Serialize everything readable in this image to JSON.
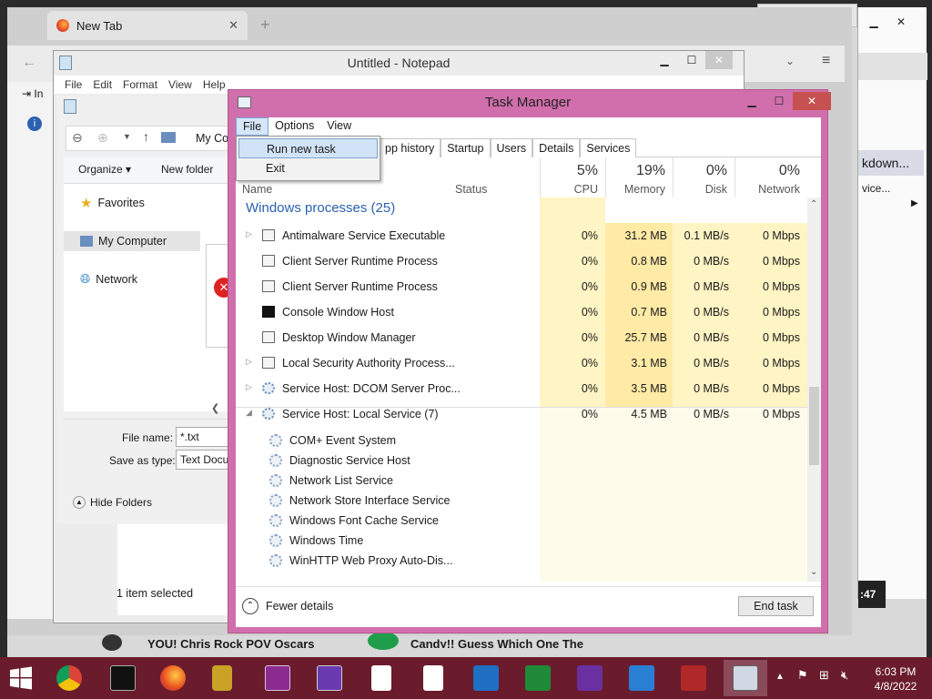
{
  "browser": {
    "tab_title": "New Tab",
    "sidebar_letters": [
      "In"
    ]
  },
  "background": {
    "news_left": "YOU! Chris Rock POV Oscars",
    "news_right": "Candy!! Guess Which One The",
    "right_panel_text1": "kdown...",
    "right_panel_text2": "vice...",
    "right_panel_badge": ":47"
  },
  "notepad": {
    "title": "Untitled - Notepad",
    "menu": [
      "File",
      "Edit",
      "Format",
      "View",
      "Help"
    ],
    "status": "1 item selected"
  },
  "save_dialog": {
    "address": "My Co",
    "organize": "Organize",
    "new_folder": "New folder",
    "nav": [
      "Favorites",
      "My Computer",
      "Network"
    ],
    "file_name_label": "File name:",
    "file_name_value": "*.txt",
    "save_type_label": "Save as type:",
    "save_type_value": "Text Docu",
    "hide_folders": "Hide Folders"
  },
  "task_manager": {
    "title": "Task Manager",
    "menu": [
      "File",
      "Options",
      "View"
    ],
    "file_menu_items": [
      "Run new task",
      "Exit"
    ],
    "tabs": [
      "pp history",
      "Startup",
      "Users",
      "Details",
      "Services"
    ],
    "columns": {
      "name": "Name",
      "status": "Status",
      "cpu_pct": "5%",
      "cpu_label": "CPU",
      "mem_pct": "19%",
      "mem_label": "Memory",
      "disk_pct": "0%",
      "disk_label": "Disk",
      "net_pct": "0%",
      "net_label": "Network"
    },
    "group_title": "Windows processes (25)",
    "processes": [
      {
        "name": "Antimalware Service Executable",
        "cpu": "0%",
        "mem": "31.2 MB",
        "disk": "0.1 MB/s",
        "net": "0 Mbps",
        "expand": "▷",
        "icon": "window"
      },
      {
        "name": "Client Server Runtime Process",
        "cpu": "0%",
        "mem": "0.8 MB",
        "disk": "0 MB/s",
        "net": "0 Mbps",
        "expand": "",
        "icon": "window"
      },
      {
        "name": "Client Server Runtime Process",
        "cpu": "0%",
        "mem": "0.9 MB",
        "disk": "0 MB/s",
        "net": "0 Mbps",
        "expand": "",
        "icon": "window"
      },
      {
        "name": "Console Window Host",
        "cpu": "0%",
        "mem": "0.7 MB",
        "disk": "0 MB/s",
        "net": "0 Mbps",
        "expand": "",
        "icon": "console"
      },
      {
        "name": "Desktop Window Manager",
        "cpu": "0%",
        "mem": "25.7 MB",
        "disk": "0 MB/s",
        "net": "0 Mbps",
        "expand": "",
        "icon": "window"
      },
      {
        "name": "Local Security Authority Process...",
        "cpu": "0%",
        "mem": "3.1 MB",
        "disk": "0 MB/s",
        "net": "0 Mbps",
        "expand": "▷",
        "icon": "window"
      },
      {
        "name": "Service Host: DCOM Server Proc...",
        "cpu": "0%",
        "mem": "3.5 MB",
        "disk": "0 MB/s",
        "net": "0 Mbps",
        "expand": "▷",
        "icon": "gear"
      },
      {
        "name": "Service Host: Local Service (7)",
        "cpu": "0%",
        "mem": "4.5 MB",
        "disk": "0 MB/s",
        "net": "0 Mbps",
        "expand": "◢",
        "icon": "gear"
      }
    ],
    "services": [
      "COM+ Event System",
      "Diagnostic Service Host",
      "Network List Service",
      "Network Store Interface Service",
      "Windows Font Cache Service",
      "Windows Time",
      "WinHTTP Web Proxy Auto-Dis..."
    ],
    "fewer_details": "Fewer details",
    "end_task": "End task"
  },
  "taskbar": {
    "time": "6:03 PM",
    "date": "4/8/2022",
    "apps": [
      "chrome",
      "console",
      "firefox",
      "lock",
      "camera",
      "calendar",
      "file",
      "file",
      "mail",
      "finance",
      "trophy",
      "weather",
      "news",
      "task-manager"
    ]
  },
  "colors": {
    "tm_frame": "#d16fac",
    "taskbar": "#6a1c2c",
    "group_blue": "#2a62b0"
  }
}
